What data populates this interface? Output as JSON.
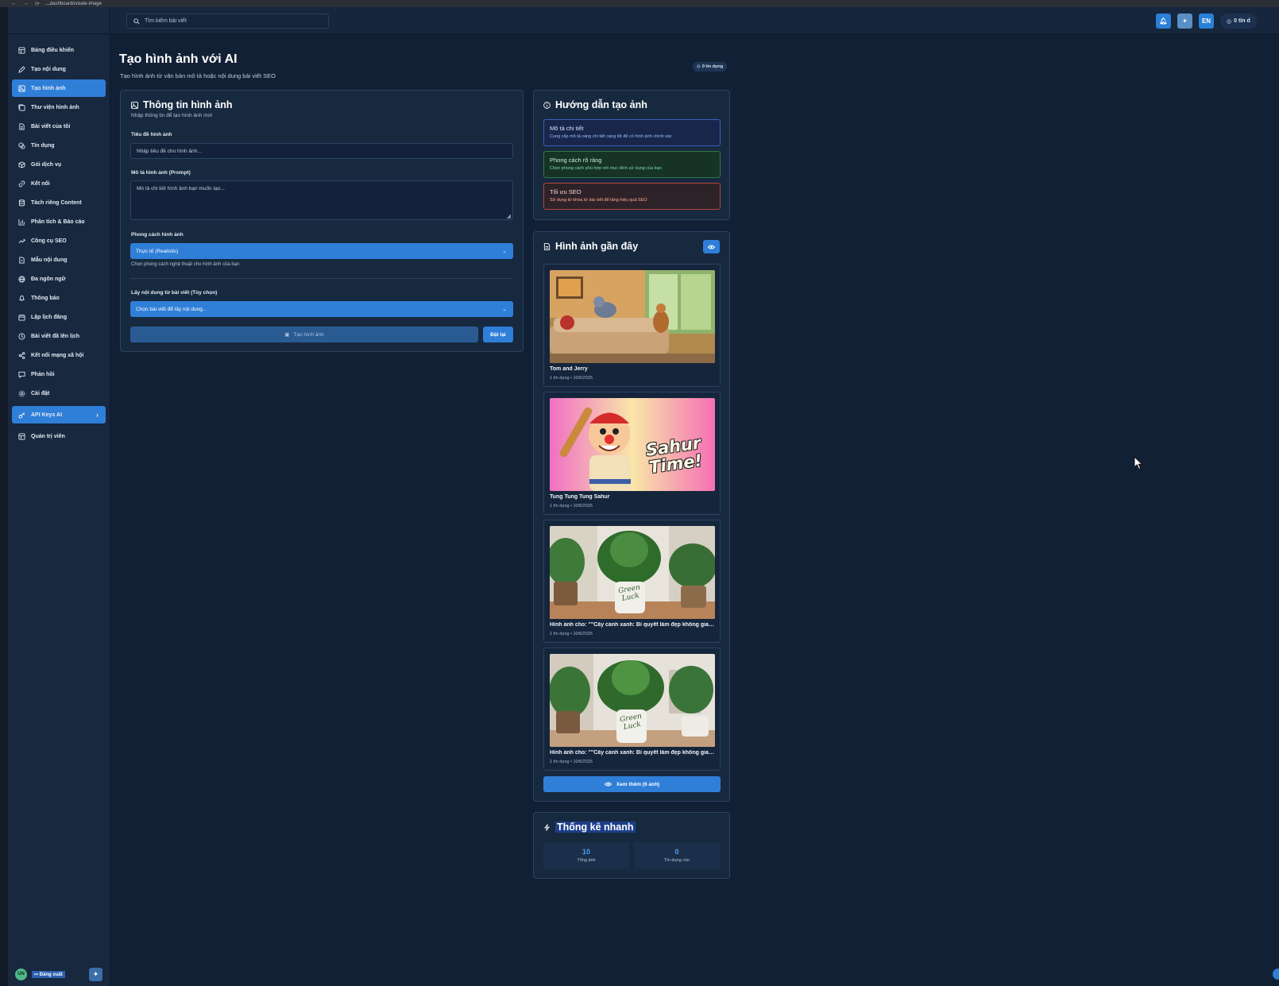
{
  "browser": {
    "url_domain": "...",
    "url_path": "dashboard/create-image"
  },
  "search": {
    "placeholder": "Tìm kiếm bài viết"
  },
  "topbar": {
    "lang": "EN",
    "credits": "0 tín d"
  },
  "sidebar": {
    "items": [
      {
        "label": "Bảng điều khiển",
        "icon": "dashboard-icon"
      },
      {
        "label": "Tạo nội dung",
        "icon": "edit-icon"
      },
      {
        "label": "Tạo hình ảnh",
        "icon": "image-icon",
        "active": true
      },
      {
        "label": "Thư viện hình ảnh",
        "icon": "gallery-icon"
      },
      {
        "label": "Bài viết của tôi",
        "icon": "file-icon"
      },
      {
        "label": "Tín dụng",
        "icon": "coins-icon"
      },
      {
        "label": "Gói dịch vụ",
        "icon": "package-icon"
      },
      {
        "label": "Kết nối",
        "icon": "link-icon"
      },
      {
        "label": "Tách riêng Content",
        "icon": "database-icon"
      },
      {
        "label": "Phân tích & Báo cáo",
        "icon": "bar-chart-icon"
      },
      {
        "label": "Công cụ SEO",
        "icon": "trend-icon"
      },
      {
        "label": "Mẫu nội dung",
        "icon": "template-icon"
      },
      {
        "label": "Đa ngôn ngữ",
        "icon": "globe-icon"
      },
      {
        "label": "Thông báo",
        "icon": "bell-icon"
      },
      {
        "label": "Lập lịch đăng",
        "icon": "calendar-icon"
      },
      {
        "label": "Bài viết đã lên lịch",
        "icon": "clock-icon"
      },
      {
        "label": "Kết nối mạng xã hội",
        "icon": "share-icon"
      },
      {
        "label": "Phản hồi",
        "icon": "message-icon"
      },
      {
        "label": "Cài đặt",
        "icon": "settings-icon"
      },
      {
        "label": "API Keys AI",
        "icon": "key-icon",
        "active": true,
        "chevron": "›"
      },
      {
        "label": "Quản trị viên",
        "icon": "admin-icon"
      }
    ],
    "footer": {
      "avatar": "UN",
      "logout": "Đăng xuất"
    }
  },
  "page": {
    "title": "Tạo hình ảnh với AI",
    "subtitle": "Tạo hình ảnh từ văn bản mô tả hoặc nội dung bài viết SEO",
    "credit_badge": "0 tín dụng"
  },
  "form": {
    "title": "Thông tin hình ảnh",
    "subtitle": "Nhập thông tin để tạo hình ảnh mới",
    "image_title_label": "Tiêu đề hình ảnh",
    "image_title_placeholder": "Nhập tiêu đề cho hình ảnh...",
    "prompt_label": "Mô tả hình ảnh (Prompt)",
    "prompt_placeholder": "Mô tả chi tiết hình ảnh bạn muốn tạo...",
    "style_label": "Phong cách hình ảnh",
    "style_value": "Thực tế (Realistic)",
    "style_hint": "Chọn phong cách nghệ thuật cho hình ảnh của bạn",
    "article_label": "Lấy nội dung từ bài viết (Tùy chọn)",
    "article_value": "Chọn bài viết để lấy nội dung...",
    "generate_label": "Tạo hình ảnh",
    "reset_label": "Đặt lại"
  },
  "guide": {
    "title": "Hướng dẫn tạo ảnh",
    "items": [
      {
        "title": "Mô tả chi tiết",
        "desc": "Cung cấp mô tả càng chi tiết càng tốt để có hình ảnh chính xác",
        "color": "blue"
      },
      {
        "title": "Phong cách rõ ràng",
        "desc": "Chọn phong cách phù hợp với mục đích sử dụng của bạn",
        "color": "green"
      },
      {
        "title": "Tối ưu SEO",
        "desc": "Sử dụng từ khóa từ bài viết để tăng hiệu quả SEO",
        "color": "red"
      }
    ]
  },
  "recent": {
    "title": "Hình ảnh gần đây",
    "items": [
      {
        "title": "Tom and Jerry",
        "meta": "1 tín dụng • 10/6/2025",
        "scene": "cartoon-living-room"
      },
      {
        "title": "Tung Tung Tung Sahur",
        "meta": "1 tín dụng • 10/6/2025",
        "scene": "sahur-time-cartoon",
        "overlay_text": "Sahur Time!"
      },
      {
        "title": "Hình ảnh cho: \"\"Cây cảnh xanh: Bí quyết làm đẹp không gian sống\"\"",
        "meta": "1 tín dụng • 10/6/2025",
        "scene": "houseplants",
        "pot_text": "Green Luck"
      },
      {
        "title": "Hình ảnh cho: \"\"Cây cảnh xanh: Bí quyết làm đẹp không gian sống\"\"",
        "meta": "1 tín dụng • 10/6/2025",
        "scene": "houseplants",
        "pot_text": "Green Luck"
      }
    ],
    "more_label": "Xem thêm (6 ảnh)"
  },
  "stats": {
    "title": "Thống kê nhanh",
    "items": [
      {
        "value": "10",
        "label": "Tổng ảnh"
      },
      {
        "value": "0",
        "label": "Tín dụng còn"
      }
    ]
  },
  "colors": {
    "accent": "#2f7fd8",
    "background": "#122036",
    "card": "#17293f"
  }
}
